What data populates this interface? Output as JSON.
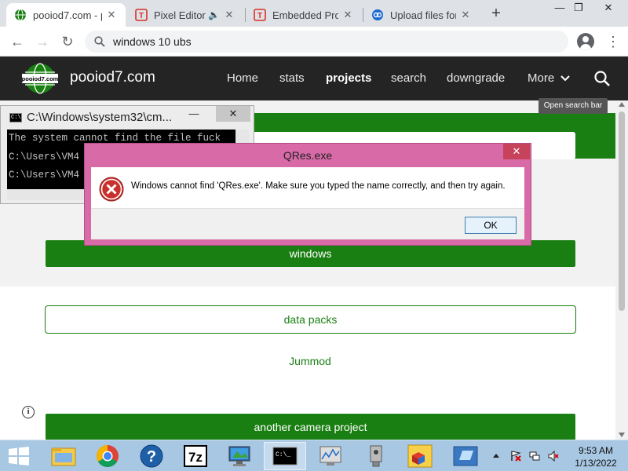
{
  "browser": {
    "tabs": [
      {
        "title": "pooiod7.com - p"
      },
      {
        "title": "Pixel Editor"
      },
      {
        "title": "Embedded Proj"
      },
      {
        "title": "Upload files for"
      }
    ],
    "new_tab_symbol": "+",
    "window_controls": {
      "minimize": "—",
      "restore": "❐",
      "close": "✕"
    },
    "address_bar": {
      "value": "windows 10 ubs"
    }
  },
  "site": {
    "name": "pooiod7.com",
    "logo_text": "pooiod7.com",
    "nav": [
      "Home",
      "stats",
      "projects",
      "search",
      "downgrade",
      "More"
    ],
    "search_tooltip": "Open search bar",
    "accent_color": "#1a7f12"
  },
  "content": {
    "buttons": [
      "windows",
      "data packs",
      "another camera project"
    ],
    "links": [
      "Jummod"
    ]
  },
  "console": {
    "title": "C:\\Windows\\system32\\cm...",
    "lines": [
      "The system cannot find the file fuck",
      "C:\\Users\\VM4",
      "C:\\Users\\VM4"
    ]
  },
  "dialog": {
    "title": "QRes.exe",
    "message": "Windows cannot find 'QRes.exe'. Make sure you typed the name correctly, and then try again.",
    "ok_label": "OK",
    "frame_color": "#d76aa7"
  },
  "taskbar": {
    "time": "9:53 AM",
    "date": "1/13/2022",
    "console_icon_text": "C:\\_"
  }
}
